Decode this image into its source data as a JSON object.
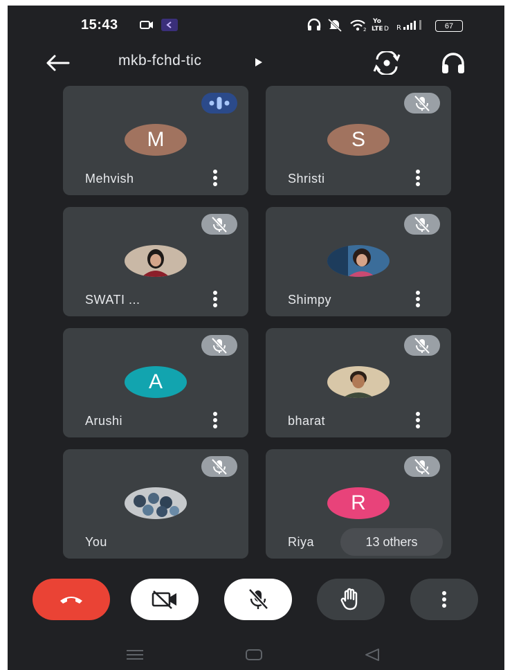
{
  "status_bar": {
    "time": "15:43",
    "battery": "67"
  },
  "header": {
    "meeting_code": "mkb-fchd-tic"
  },
  "participants": [
    {
      "name": "Mehvish",
      "initial": "M",
      "avatar_color": "#a1735f",
      "mic": "speaking"
    },
    {
      "name": "Shristi",
      "initial": "S",
      "avatar_color": "#a1735f",
      "mic": "muted"
    },
    {
      "name": "SWATI ...",
      "initial": "",
      "avatar_color": "#6d4c41",
      "mic": "muted"
    },
    {
      "name": "Shimpy",
      "initial": "",
      "avatar_color": "#4a6a8a",
      "mic": "muted"
    },
    {
      "name": "Arushi",
      "initial": "A",
      "avatar_color": "#12a4af",
      "mic": "muted"
    },
    {
      "name": "bharat",
      "initial": "",
      "avatar_color": "#8d6e63",
      "mic": "muted"
    },
    {
      "name": "You",
      "initial": "",
      "avatar_color": "#5d7a94",
      "mic": "muted"
    },
    {
      "name": "Riya",
      "initial": "R",
      "avatar_color": "#e8437a",
      "mic": "muted"
    }
  ],
  "others_chip": "13 others",
  "colors": {
    "end_call": "#ea4335",
    "control_light": "#ffffff",
    "control_dark": "#3c4043",
    "background": "#202124"
  }
}
